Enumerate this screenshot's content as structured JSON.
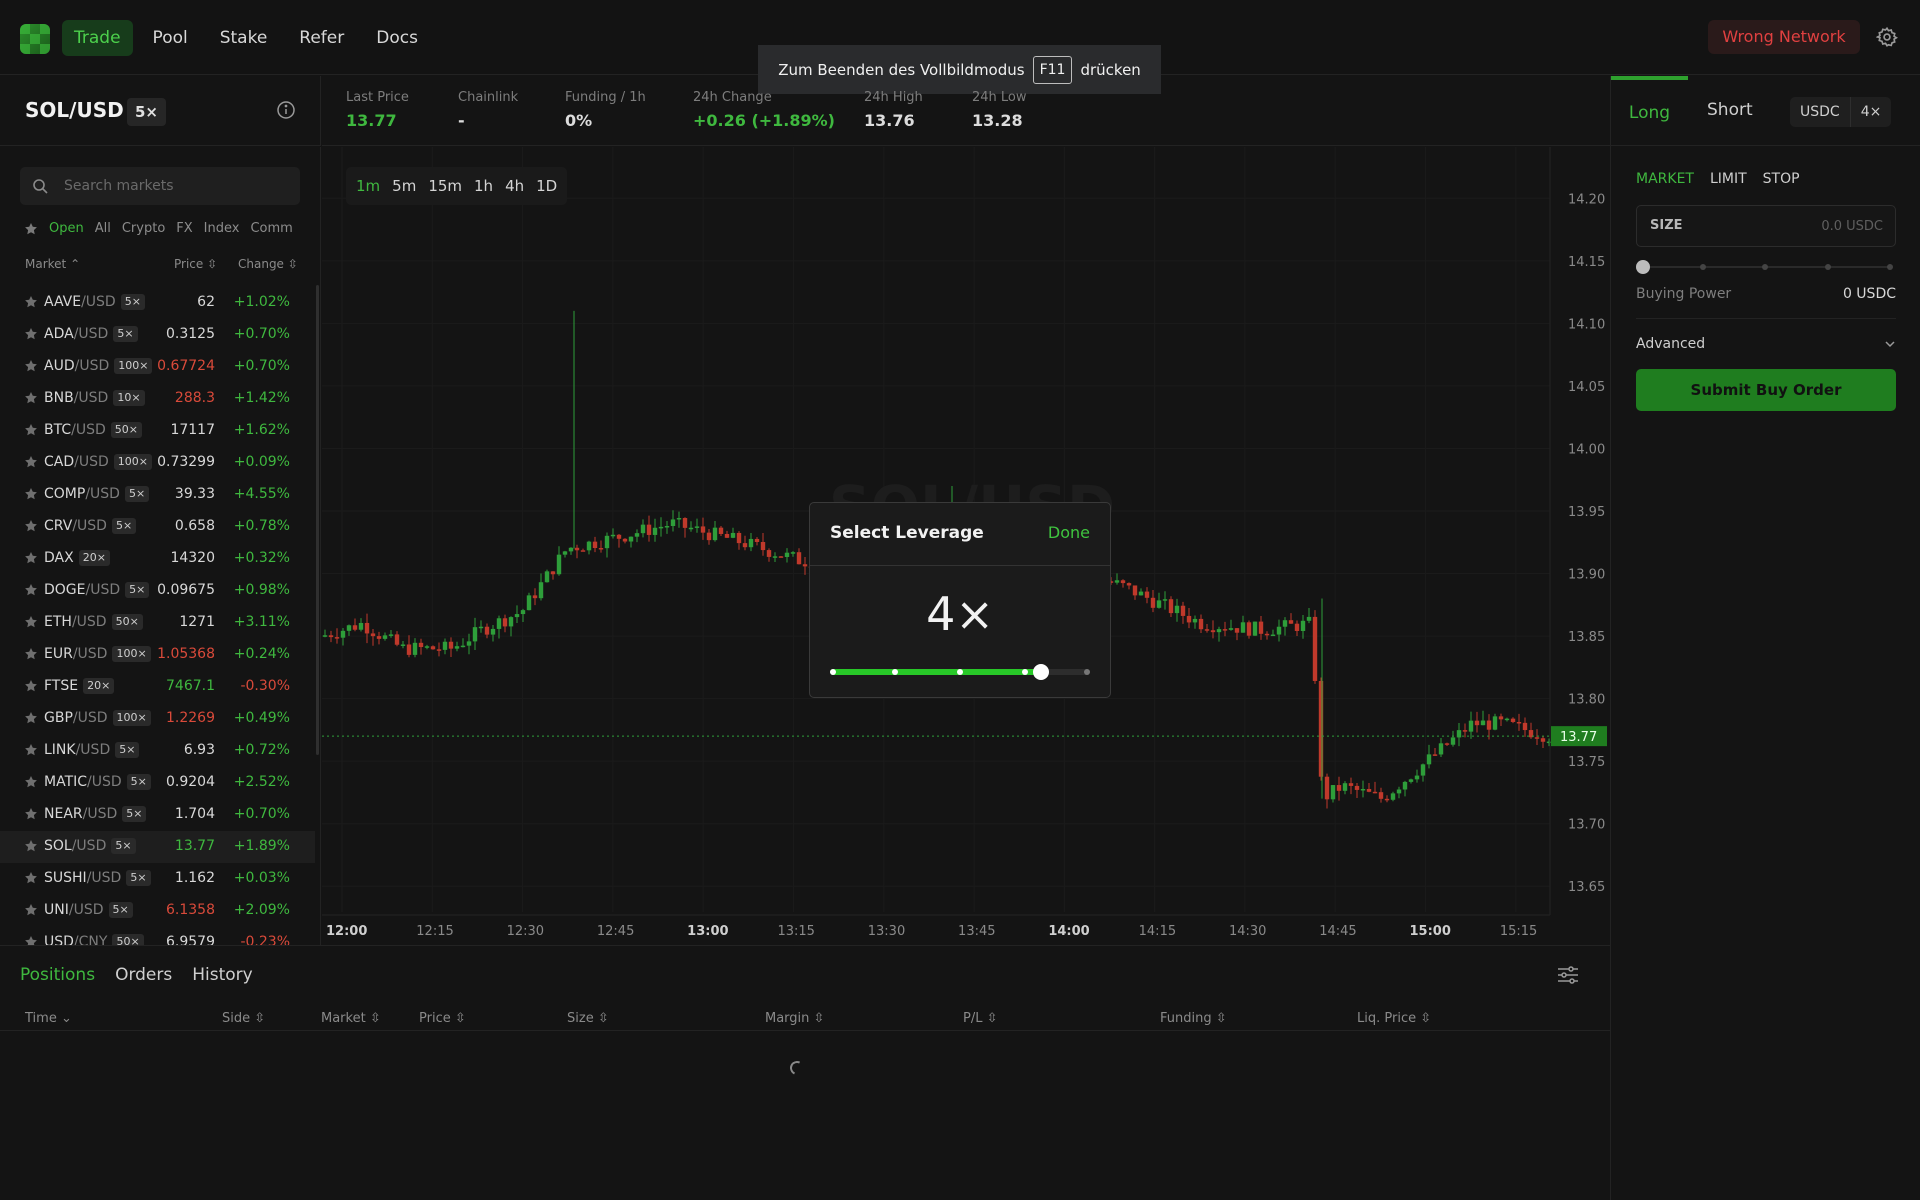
{
  "nav": {
    "items": [
      {
        "label": "Trade",
        "active": true
      },
      {
        "label": "Pool",
        "active": false
      },
      {
        "label": "Stake",
        "active": false
      },
      {
        "label": "Refer",
        "active": false
      },
      {
        "label": "Docs",
        "active": false
      }
    ],
    "wrong_network": "Wrong Network"
  },
  "fullscreen_toast": {
    "before": "Zum Beenden des Vollbildmodus",
    "key": "F11",
    "after": "drücken"
  },
  "market": {
    "name": "SOL/USD",
    "leverage": "5×"
  },
  "stats": [
    {
      "label": "Last Price",
      "value": "13.77",
      "tone": "green"
    },
    {
      "label": "Chainlink",
      "value": "-",
      "tone": "neutral"
    },
    {
      "label": "Funding / 1h",
      "value": "0%",
      "tone": "neutral"
    },
    {
      "label": "24h Change",
      "value": "+0.26 (+1.89%)",
      "tone": "green"
    },
    {
      "label": "24h High",
      "value": "13.76",
      "tone": "neutral"
    },
    {
      "label": "24h Low",
      "value": "13.28",
      "tone": "neutral"
    }
  ],
  "markets_panel": {
    "search_placeholder": "Search markets",
    "filters": [
      "Open",
      "All",
      "Crypto",
      "FX",
      "Index",
      "Comm"
    ],
    "active_filter": "Open",
    "columns": {
      "market": "Market",
      "price": "Price",
      "change": "Change"
    },
    "rows": [
      {
        "base": "AAVE",
        "quote": "/USD",
        "lev": "5×",
        "price": "62",
        "price_tone": "neutral",
        "change": "+1.02%",
        "tone": "green"
      },
      {
        "base": "ADA",
        "quote": "/USD",
        "lev": "5×",
        "price": "0.3125",
        "price_tone": "neutral",
        "change": "+0.70%",
        "tone": "green"
      },
      {
        "base": "AUD",
        "quote": "/USD",
        "lev": "100×",
        "price": "0.67724",
        "price_tone": "red",
        "change": "+0.70%",
        "tone": "green"
      },
      {
        "base": "BNB",
        "quote": "/USD",
        "lev": "10×",
        "price": "288.3",
        "price_tone": "red",
        "change": "+1.42%",
        "tone": "green"
      },
      {
        "base": "BTC",
        "quote": "/USD",
        "lev": "50×",
        "price": "17117",
        "price_tone": "neutral",
        "change": "+1.62%",
        "tone": "green"
      },
      {
        "base": "CAD",
        "quote": "/USD",
        "lev": "100×",
        "price": "0.73299",
        "price_tone": "neutral",
        "change": "+0.09%",
        "tone": "green"
      },
      {
        "base": "COMP",
        "quote": "/USD",
        "lev": "5×",
        "price": "39.33",
        "price_tone": "neutral",
        "change": "+4.55%",
        "tone": "green"
      },
      {
        "base": "CRV",
        "quote": "/USD",
        "lev": "5×",
        "price": "0.658",
        "price_tone": "neutral",
        "change": "+0.78%",
        "tone": "green"
      },
      {
        "base": "DAX",
        "quote": "",
        "lev": "20×",
        "price": "14320",
        "price_tone": "neutral",
        "change": "+0.32%",
        "tone": "green"
      },
      {
        "base": "DOGE",
        "quote": "/USD",
        "lev": "5×",
        "price": "0.09675",
        "price_tone": "neutral",
        "change": "+0.98%",
        "tone": "green"
      },
      {
        "base": "ETH",
        "quote": "/USD",
        "lev": "50×",
        "price": "1271",
        "price_tone": "neutral",
        "change": "+3.11%",
        "tone": "green"
      },
      {
        "base": "EUR",
        "quote": "/USD",
        "lev": "100×",
        "price": "1.05368",
        "price_tone": "red",
        "change": "+0.24%",
        "tone": "green"
      },
      {
        "base": "FTSE",
        "quote": "",
        "lev": "20×",
        "price": "7467.1",
        "price_tone": "green",
        "change": "-0.30%",
        "tone": "red"
      },
      {
        "base": "GBP",
        "quote": "/USD",
        "lev": "100×",
        "price": "1.2269",
        "price_tone": "red",
        "change": "+0.49%",
        "tone": "green"
      },
      {
        "base": "LINK",
        "quote": "/USD",
        "lev": "5×",
        "price": "6.93",
        "price_tone": "neutral",
        "change": "+0.72%",
        "tone": "green"
      },
      {
        "base": "MATIC",
        "quote": "/USD",
        "lev": "5×",
        "price": "0.9204",
        "price_tone": "neutral",
        "change": "+2.52%",
        "tone": "green"
      },
      {
        "base": "NEAR",
        "quote": "/USD",
        "lev": "5×",
        "price": "1.704",
        "price_tone": "neutral",
        "change": "+0.70%",
        "tone": "green"
      },
      {
        "base": "SOL",
        "quote": "/USD",
        "lev": "5×",
        "price": "13.77",
        "price_tone": "green",
        "change": "+1.89%",
        "tone": "green",
        "selected": true
      },
      {
        "base": "SUSHI",
        "quote": "/USD",
        "lev": "5×",
        "price": "1.162",
        "price_tone": "neutral",
        "change": "+0.03%",
        "tone": "green"
      },
      {
        "base": "UNI",
        "quote": "/USD",
        "lev": "5×",
        "price": "6.1358",
        "price_tone": "red",
        "change": "+2.09%",
        "tone": "green"
      },
      {
        "base": "USD",
        "quote": "/CNY",
        "lev": "50×",
        "price": "6.9579",
        "price_tone": "neutral",
        "change": "-0.23%",
        "tone": "red"
      }
    ]
  },
  "chart": {
    "timeframes": [
      "1m",
      "5m",
      "15m",
      "1h",
      "4h",
      "1D"
    ],
    "active_timeframe": "1m",
    "watermark": "SOL/USD",
    "price_ticks": [
      "14.20",
      "14.15",
      "14.10",
      "14.05",
      "14.00",
      "13.95",
      "13.90",
      "13.85",
      "13.80",
      "13.75",
      "13.70",
      "13.65"
    ],
    "time_ticks": [
      {
        "label": "12:00",
        "bold": true
      },
      {
        "label": "12:15",
        "bold": false
      },
      {
        "label": "12:30",
        "bold": false
      },
      {
        "label": "12:45",
        "bold": false
      },
      {
        "label": "13:00",
        "bold": true
      },
      {
        "label": "13:15",
        "bold": false
      },
      {
        "label": "13:30",
        "bold": false
      },
      {
        "label": "13:45",
        "bold": false
      },
      {
        "label": "14:00",
        "bold": true
      },
      {
        "label": "14:15",
        "bold": false
      },
      {
        "label": "14:30",
        "bold": false
      },
      {
        "label": "14:45",
        "bold": false
      },
      {
        "label": "15:00",
        "bold": true
      },
      {
        "label": "15:15",
        "bold": false
      }
    ],
    "y_range": [
      13.635,
      14.225
    ],
    "last_price": "13.77",
    "last_price_value": 13.77,
    "colors": {
      "up": "#2e9e3a",
      "down": "#c0392b"
    }
  },
  "order_panel": {
    "long_label": "Long",
    "short_label": "Short",
    "collateral": "USDC",
    "leverage": "4×",
    "order_types": [
      "MARKET",
      "LIMIT",
      "STOP"
    ],
    "active_type": "MARKET",
    "size_label": "SIZE",
    "size_placeholder": "0.0 USDC",
    "size_fraction": 0,
    "buying_power_label": "Buying Power",
    "buying_power_value": "0 USDC",
    "advanced_label": "Advanced",
    "submit_label": "Submit Buy Order"
  },
  "positions": {
    "tabs": [
      "Positions",
      "Orders",
      "History"
    ],
    "active_tab": "Positions",
    "columns": [
      "Time",
      "Side",
      "Market",
      "Price",
      "Size",
      "Margin",
      "P/L",
      "Funding",
      "Liq. Price"
    ]
  },
  "leverage_modal": {
    "title": "Select Leverage",
    "done": "Done",
    "value": "4×",
    "fraction": 0.8125
  }
}
